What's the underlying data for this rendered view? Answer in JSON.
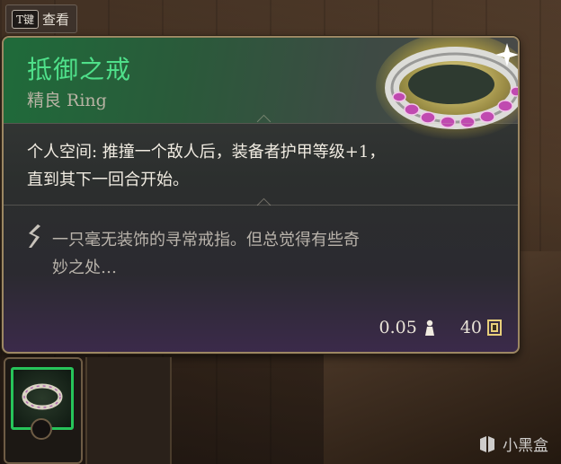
{
  "peek_hint": {
    "key": "T键",
    "label": "查看"
  },
  "item": {
    "name": "抵御之戒",
    "subtitle": "精良 Ring",
    "rarity_color": "#4fe08a",
    "description": "个人空间: 推撞一个敌人后，装备者护甲等级+1，直到其下一回合开始。",
    "flavor": "一只毫无装饰的寻常戒指。但总觉得有些奇妙之处…",
    "weight": "0.05",
    "weight_icon": "weight-icon",
    "value": "40",
    "value_icon": "gold-coin-icon"
  },
  "watermark": "小黑盒"
}
